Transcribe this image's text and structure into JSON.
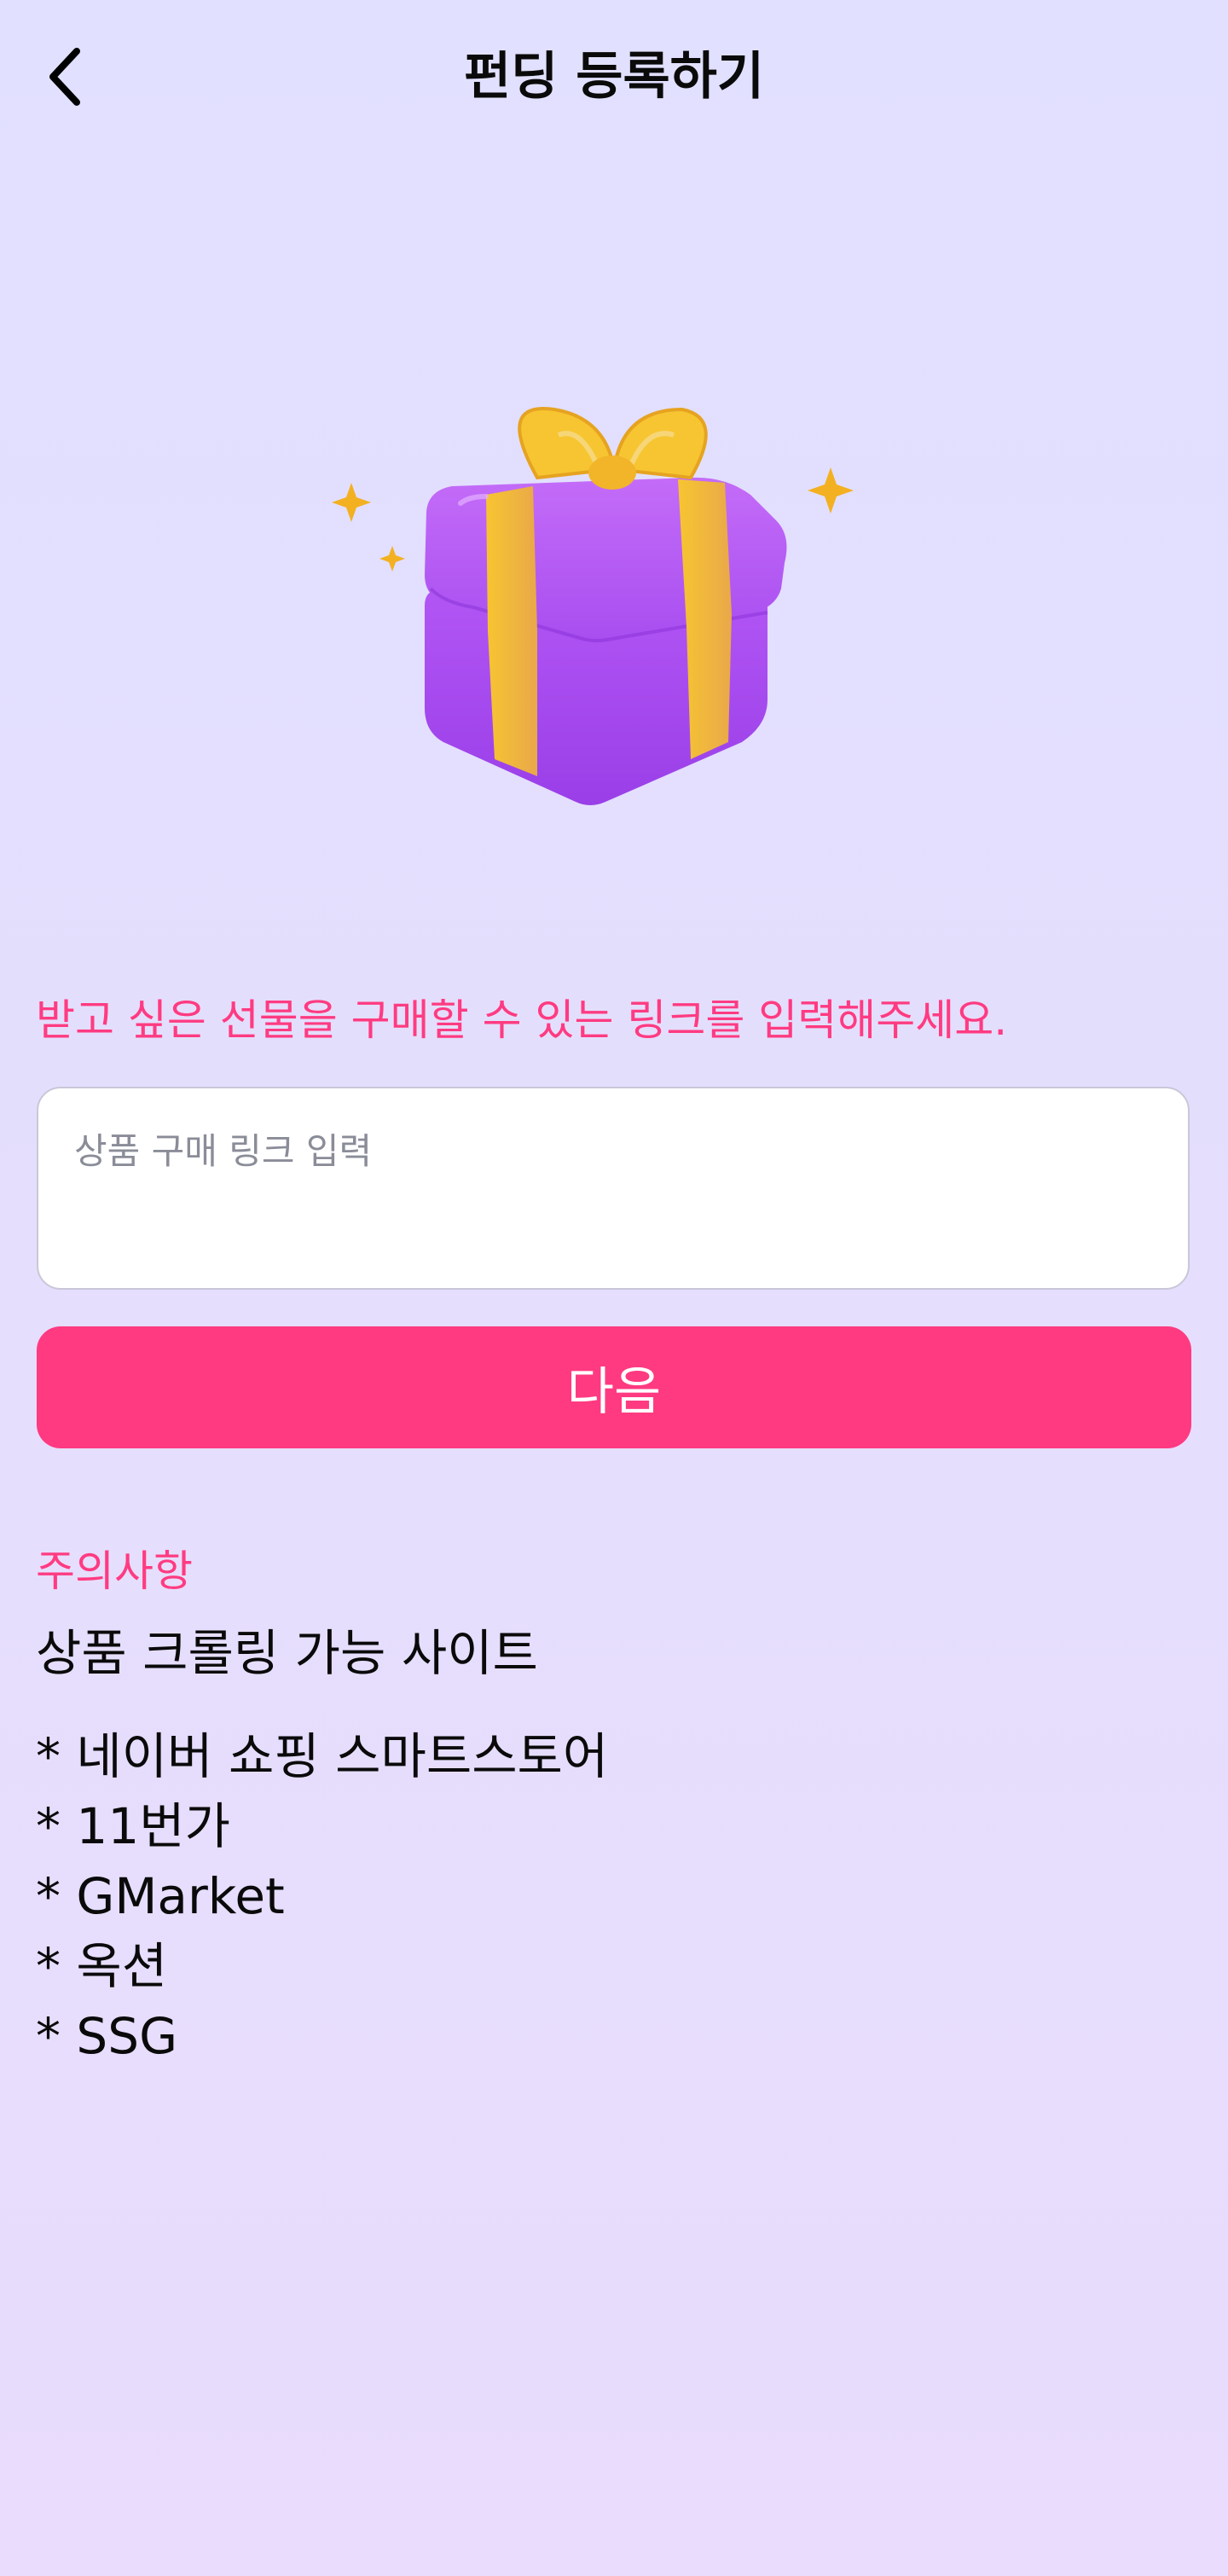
{
  "header": {
    "title": "펀딩 등록하기",
    "back_icon": "chevron-left-icon"
  },
  "hero": {
    "icon": "gift-box-icon",
    "colors": {
      "box": "#a64cf0",
      "ribbon": "#f5c02a",
      "sparkle": "#f3b021"
    }
  },
  "form": {
    "instruction": "받고 싶은 선물을 구매할 수 있는 링크를 입력해주세요.",
    "link_input": {
      "placeholder": "상품 구매 링크 입력",
      "value": ""
    },
    "next_label": "다음"
  },
  "notice": {
    "title": "주의사항",
    "subtitle": "상품 크롤링 가능 사이트",
    "sites": [
      "* 네이버 쇼핑 스마트스토어",
      "* 11번가",
      "* GMarket",
      "* 옥션",
      "* SSG"
    ]
  },
  "colors": {
    "accent": "#ff3a81",
    "background": "#e3defd",
    "input_bg": "#ffffff"
  }
}
